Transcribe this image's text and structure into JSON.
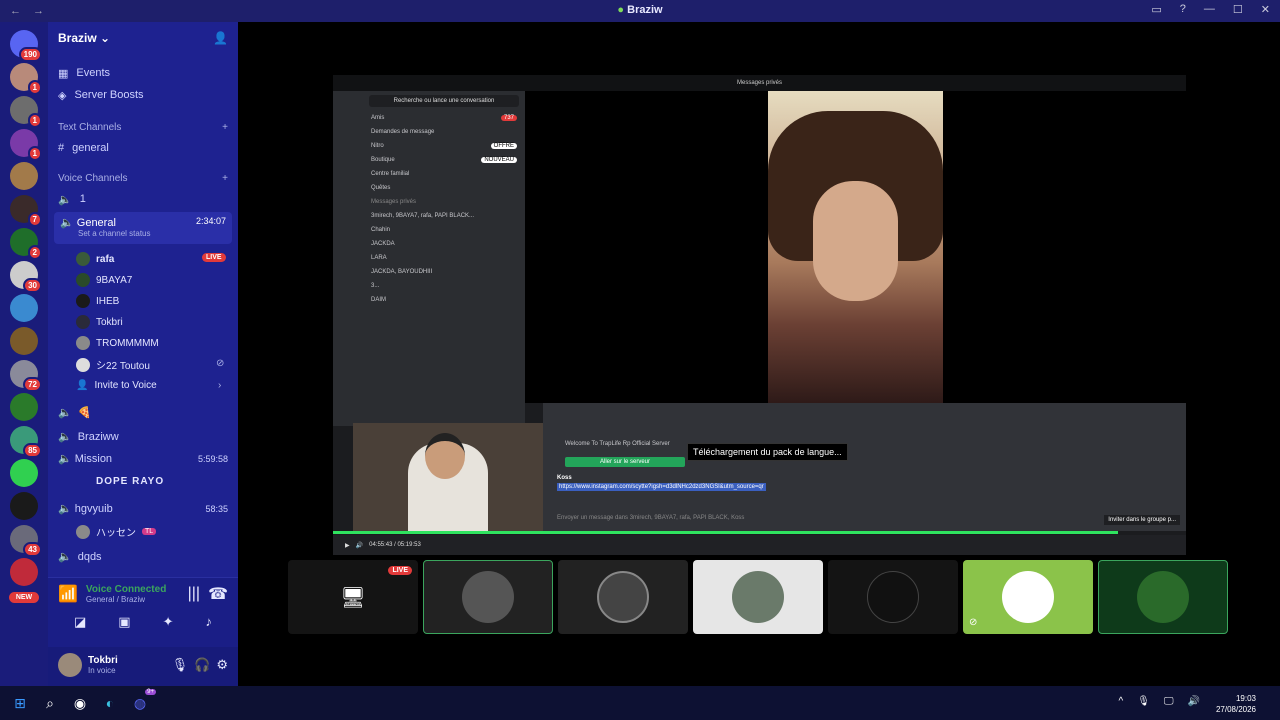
{
  "window": {
    "title": "Braziw"
  },
  "guilds": {
    "home_badge": "190",
    "items": [
      {
        "badge": "1",
        "color": "#b88a7a"
      },
      {
        "badge": "1",
        "color": "#6d6d6d"
      },
      {
        "badge": "1",
        "color": "#7a3aa8"
      },
      {
        "badge": "",
        "color": "#a27a4a"
      },
      {
        "badge": "7",
        "color": "#3a2a2a"
      },
      {
        "badge": "2",
        "color": "#1f6e2a"
      },
      {
        "badge": "30",
        "color": "#cccccc"
      },
      {
        "badge": "",
        "color": "#3a8ad0"
      },
      {
        "badge": "",
        "color": "#7a5a2a"
      },
      {
        "badge": "72",
        "color": "#8a8a9a"
      },
      {
        "badge": "",
        "color": "#2a7a2a"
      },
      {
        "badge": "85",
        "color": "#3a9a7a"
      },
      {
        "badge": "",
        "color": "#30d050"
      },
      {
        "badge": "",
        "color": "#1a1a1a"
      },
      {
        "badge": "43",
        "color": "#6a6a7a"
      },
      {
        "badge": "",
        "color": "#c02a3a"
      }
    ],
    "new_label": "NEW"
  },
  "sidebar": {
    "server_name": "Braziw",
    "events": "Events",
    "boosts": "Server Boosts",
    "text_channels_label": "Text Channels",
    "text_channels": [
      "general"
    ],
    "voice_channels_label": "Voice Channels",
    "voice_channel_1": "1",
    "general_voice": {
      "name": "General",
      "timer": "2:34:07",
      "status": "Set a channel status"
    },
    "members": [
      {
        "name": "rafa",
        "live": "LIVE"
      },
      {
        "name": "9BAYA7"
      },
      {
        "name": "IHEB"
      },
      {
        "name": "Tokbri"
      },
      {
        "name": "TROMMMMM"
      },
      {
        "name": "シ22 Toutou"
      }
    ],
    "invite": "Invite to Voice",
    "channels_after": [
      {
        "name": "🍕",
        "timer": ""
      },
      {
        "name": "Braziww",
        "timer": ""
      },
      {
        "name": "Mission",
        "timer": "5:59:58"
      }
    ],
    "mission_member": "DOPE RAYO",
    "hgvyuib": {
      "name": "hgvyuib",
      "timer": "58:35"
    },
    "hgvyuib_member": "ハッセン",
    "hgvyuib_tag": "TL",
    "dqds": "dqds"
  },
  "voice_panel": {
    "title": "Voice Connected",
    "subtitle": "General / Braziw"
  },
  "user_panel": {
    "name": "Tokbri",
    "status": "In voice"
  },
  "stream": {
    "app_title": "Messages privés",
    "search": "Recherche ou lance une conversation",
    "nav": [
      "Amis",
      "Demandes de message",
      "Nitro",
      "Boutique",
      "Centre familial",
      "Quêtes"
    ],
    "friends_badge": "737",
    "nitro_badge": "OFFRE",
    "shop_badge": "NOUVEAU",
    "dm_header": "Messages privés",
    "dms": [
      "3mirech, 9BAYA7, rafa, PAPI BLACK...",
      "Chahin",
      "JACKDA",
      "LARA",
      "JACKDA, BAYOUDHIII",
      "3...",
      "DAIM"
    ],
    "welcome": "Welcome To TrapLife Rp Official Server",
    "join": "Aller sur le serveur",
    "tooltip": "Téléchargement du pack de langue...",
    "author": "Koss",
    "link": "https://www.instagram.com/scytte?igsh=d3dlNHc2dzd3NGSl&utm_source=qr",
    "input": "Envoyer un message dans 3mirech, 9BAYA7, rafa, PAPI BLACK, Koss",
    "invite": "Inviter dans le groupe p...",
    "time": "04:55:43 / 05:19:53",
    "progress": 0.92
  },
  "tiles": {
    "live": "LIVE"
  },
  "taskbar": {
    "time": "19:03",
    "date": "27/08/2026",
    "discord_badge": "9+"
  }
}
